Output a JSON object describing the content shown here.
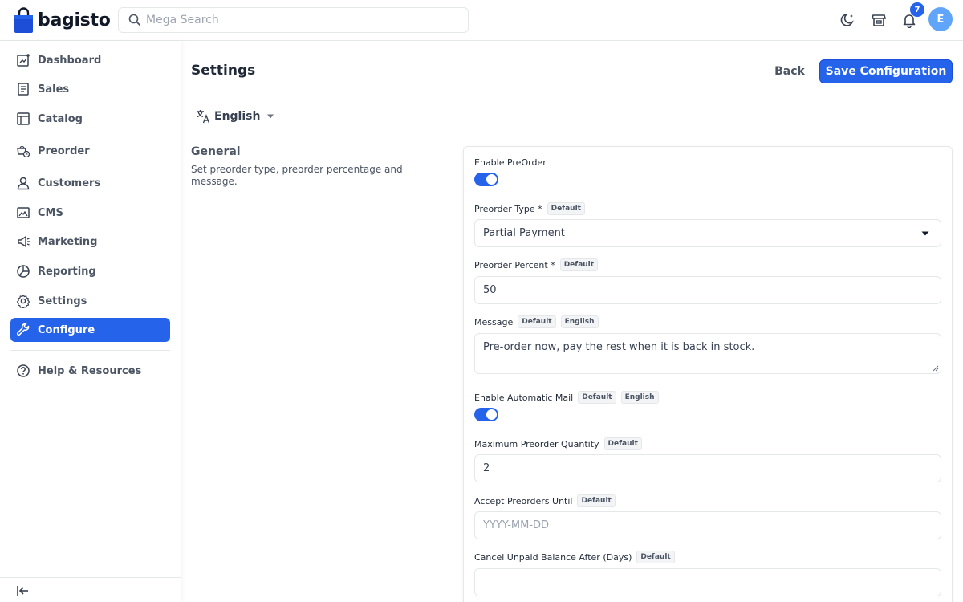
{
  "app": {
    "brand": "bagisto"
  },
  "header": {
    "search_placeholder": "Mega Search",
    "notification_count": "7",
    "avatar_initial": "E"
  },
  "sidebar": {
    "items": [
      {
        "label": "Dashboard",
        "icon": "dashboard-icon"
      },
      {
        "label": "Sales",
        "icon": "sales-icon"
      },
      {
        "label": "Catalog",
        "icon": "catalog-icon"
      },
      {
        "label": "Preorder",
        "icon": "preorder-icon"
      },
      {
        "label": "Customers",
        "icon": "customers-icon"
      },
      {
        "label": "CMS",
        "icon": "cms-icon"
      },
      {
        "label": "Marketing",
        "icon": "marketing-icon"
      },
      {
        "label": "Reporting",
        "icon": "reporting-icon"
      },
      {
        "label": "Settings",
        "icon": "settings-icon"
      },
      {
        "label": "Configure",
        "icon": "configure-icon",
        "active": true
      }
    ],
    "help": {
      "label": "Help & Resources",
      "icon": "help-icon"
    }
  },
  "main": {
    "title": "Settings",
    "back_label": "Back",
    "save_label": "Save Configuration",
    "locale": "English",
    "section": {
      "title": "General",
      "description": "Set preorder type, preorder percentage and message."
    },
    "fields": {
      "enable_preorder": {
        "label": "Enable PreOrder",
        "checked": true
      },
      "preorder_type": {
        "label": "Preorder Type *",
        "tag": "Default",
        "value": "Partial Payment"
      },
      "preorder_percent": {
        "label": "Preorder Percent *",
        "tag": "Default",
        "value": "50"
      },
      "message": {
        "label": "Message",
        "tags": [
          "Default",
          "English"
        ],
        "value": "Pre-order now, pay the rest when it is back in stock."
      },
      "enable_mail": {
        "label": "Enable Automatic Mail",
        "tags": [
          "Default",
          "English"
        ],
        "checked": true
      },
      "max_qty": {
        "label": "Maximum Preorder Quantity",
        "tag": "Default",
        "value": "2"
      },
      "accept_until": {
        "label": "Accept Preorders Until",
        "tag": "Default",
        "placeholder": "YYYY-MM-DD"
      },
      "cancel_after": {
        "label": "Cancel Unpaid Balance After (Days)",
        "tag": "Default",
        "value": ""
      }
    }
  },
  "colors": {
    "accent": "#2563eb",
    "avatar": "#60a5fa"
  }
}
